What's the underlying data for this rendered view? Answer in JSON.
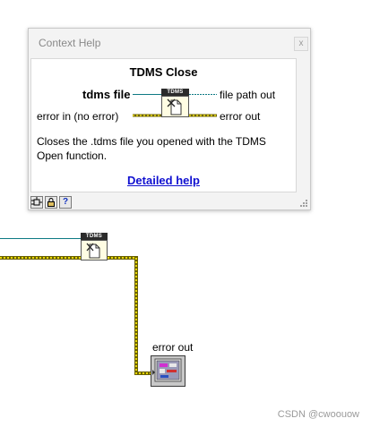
{
  "window": {
    "title": "Context Help",
    "close_label": "x"
  },
  "help": {
    "title": "TDMS Close",
    "terminals": {
      "tdms_file": "tdms file",
      "error_in": "error in (no error)",
      "file_path_out": "file path out",
      "error_out": "error out"
    },
    "node_label": "TDMS",
    "description": "Closes the .tdms file you opened with the TDMS Open function.",
    "link": "Detailed help"
  },
  "toolbar": {
    "buttons": [
      "show-optional-terminals-icon",
      "lock-icon",
      "question-icon"
    ],
    "question_label": "?"
  },
  "diagram": {
    "node_label": "TDMS",
    "indicator_label": "error out"
  },
  "watermark": "CSDN @cwoouow",
  "colors": {
    "error_wire": "#d4c300",
    "refnum_wire": "#0e7a84",
    "path_wire": "#0e7a84",
    "link": "#1010d0"
  }
}
